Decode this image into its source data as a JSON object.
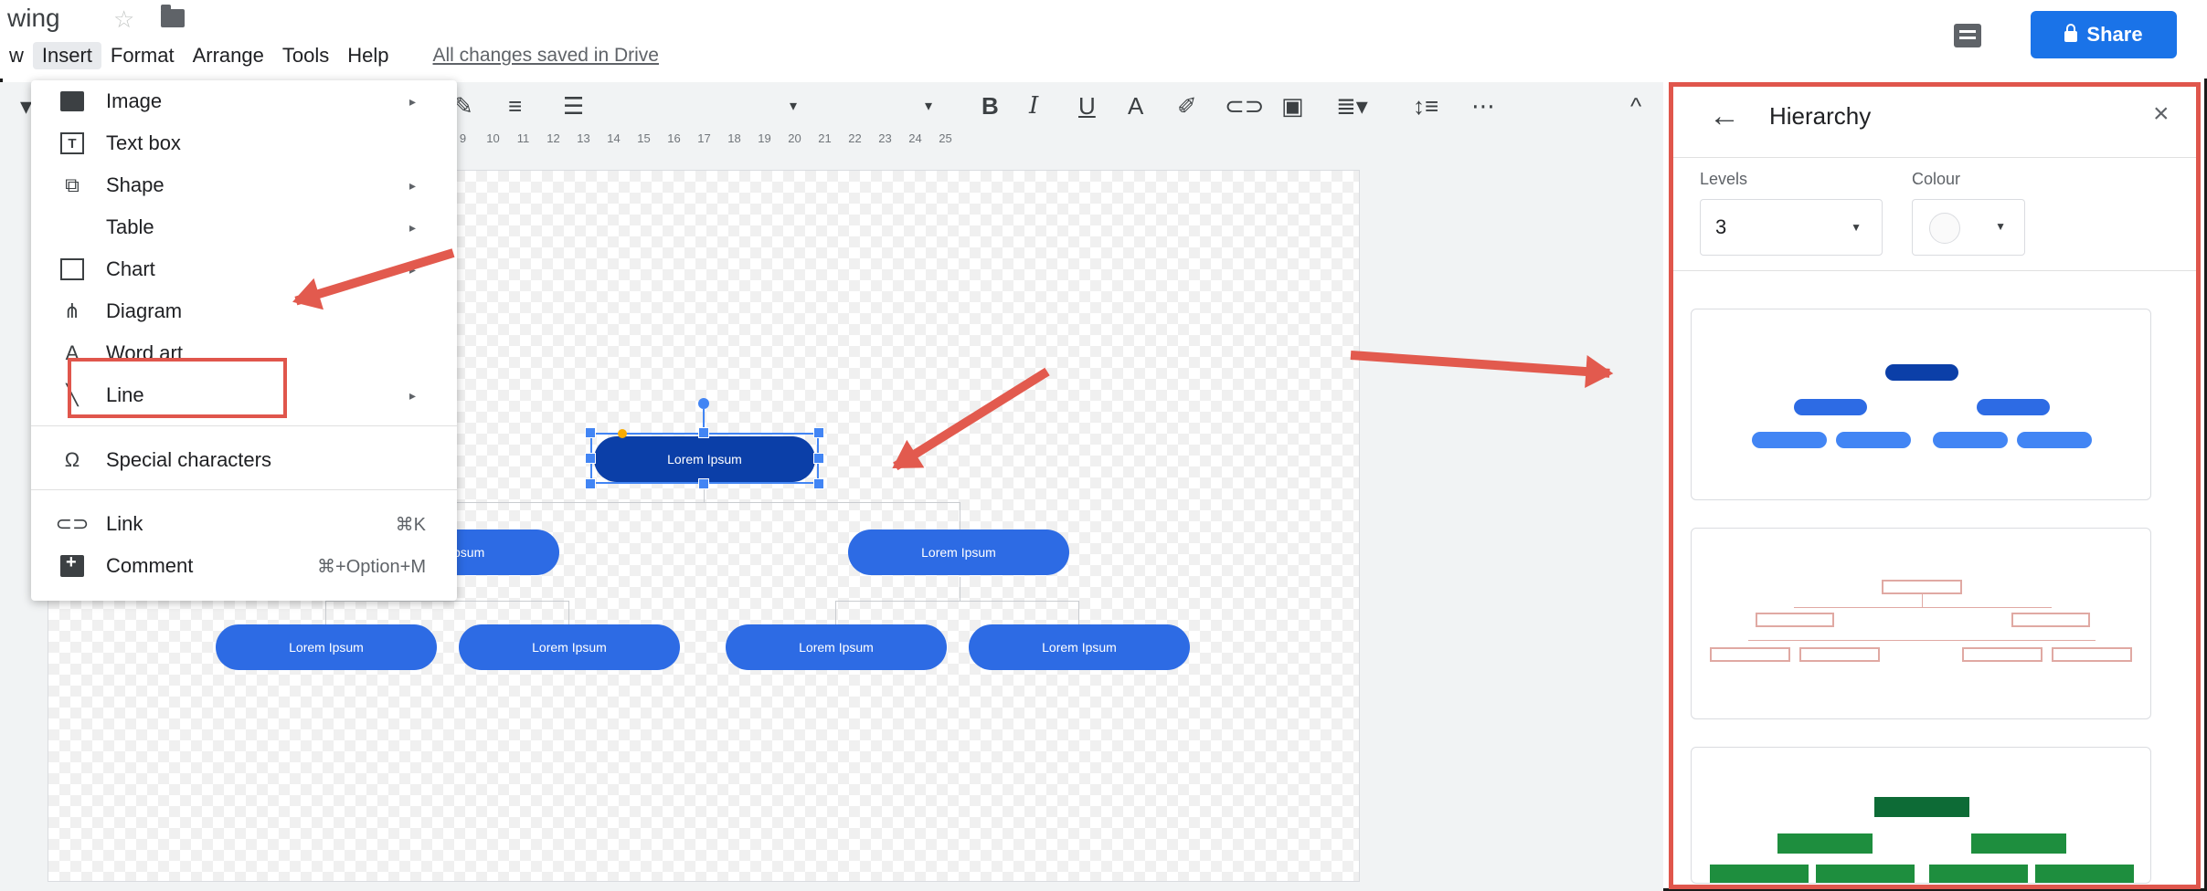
{
  "header": {
    "doc_title": "wing",
    "menu": [
      "w",
      "Insert",
      "Format",
      "Arrange",
      "Tools",
      "Help"
    ],
    "saved_status": "All changes saved in Drive",
    "share_label": "Share"
  },
  "toolbar": {
    "bold": "B",
    "italic": "I",
    "underline": "U",
    "font_color": "A",
    "more": "⋯",
    "collapse": "^"
  },
  "ruler": [
    "9",
    "10",
    "11",
    "12",
    "13",
    "14",
    "15",
    "16",
    "17",
    "18",
    "19",
    "20",
    "21",
    "22",
    "23",
    "24",
    "25"
  ],
  "insert_menu": {
    "items": [
      {
        "label": "Image",
        "icon": "image-icon",
        "submenu": true
      },
      {
        "label": "Text box",
        "icon": "textbox-icon",
        "submenu": false
      },
      {
        "label": "Shape",
        "icon": "shape-icon",
        "submenu": true
      },
      {
        "label": "Table",
        "icon": "",
        "submenu": true
      },
      {
        "label": "Chart",
        "icon": "chart-icon",
        "submenu": true
      },
      {
        "label": "Diagram",
        "icon": "diagram-icon",
        "submenu": false
      },
      {
        "label": "Word art",
        "icon": "wordart-icon",
        "submenu": false
      },
      {
        "label": "Line",
        "icon": "line-icon",
        "submenu": true
      },
      {
        "label": "Special characters",
        "icon": "omega-icon",
        "submenu": false
      },
      {
        "label": "Link",
        "icon": "link-icon",
        "shortcut": "⌘K"
      },
      {
        "label": "Comment",
        "icon": "comment-icon",
        "shortcut": "⌘+Option+M"
      }
    ]
  },
  "diagram": {
    "root": "Lorem Ipsum",
    "level2": [
      "Lorem Ipsum",
      "Lorem Ipsum"
    ],
    "level2_partial": "psum",
    "level3": [
      "Lorem Ipsum",
      "Lorem Ipsum",
      "Lorem Ipsum",
      "Lorem Ipsum"
    ]
  },
  "panel": {
    "title": "Hierarchy",
    "levels_label": "Levels",
    "levels_value": "3",
    "colour_label": "Colour"
  },
  "colors": {
    "accent": "#1a73e8",
    "node": "#2d6be4",
    "root_node": "#0b3fa8",
    "annotation": "#e0564c"
  }
}
